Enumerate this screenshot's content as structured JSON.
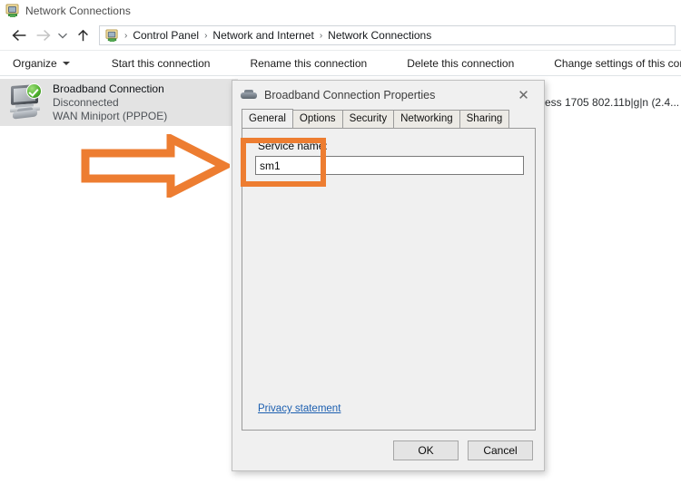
{
  "window": {
    "title": "Network Connections",
    "icon": "network-connections-icon"
  },
  "navigation": {
    "back_icon": "back-arrow-icon",
    "forward_icon": "forward-arrow-icon",
    "recent_icon": "chevron-down-icon",
    "up_icon": "up-arrow-icon",
    "breadcrumb_icon": "network-connections-icon",
    "breadcrumbs": [
      "Control Panel",
      "Network and Internet",
      "Network Connections"
    ],
    "separator": "›"
  },
  "command_bar": {
    "organize": "Organize",
    "organize_caret": "caret-down-icon",
    "items": [
      "Start this connection",
      "Rename this connection",
      "Delete this connection",
      "Change settings of this connection"
    ]
  },
  "connections": [
    {
      "name": "Broadband Connection",
      "status": "Disconnected",
      "device": "WAN Miniport (PPPOE)",
      "selected": true,
      "badge": "connected-check-icon"
    }
  ],
  "truncated_item_text": "ess 1705 802.11b|g|n (2.4...",
  "dialog": {
    "title": "Broadband Connection Properties",
    "icon": "modem-icon",
    "close_label": "✕",
    "tabs": [
      {
        "label": "General",
        "active": true
      },
      {
        "label": "Options",
        "active": false
      },
      {
        "label": "Security",
        "active": false
      },
      {
        "label": "Networking",
        "active": false
      },
      {
        "label": "Sharing",
        "active": false
      }
    ],
    "general": {
      "service_name_label": "Service name:",
      "service_name_value": "sm1",
      "service_name_placeholder": "",
      "privacy_link": "Privacy statement"
    },
    "buttons": {
      "ok": "OK",
      "cancel": "Cancel"
    }
  },
  "annotations": {
    "arrow": {
      "name": "orange-pointer-arrow",
      "color": "#ED7D31",
      "direction": "right"
    },
    "highlight_box": {
      "name": "orange-highlight-box",
      "color": "#ED7D31"
    }
  }
}
